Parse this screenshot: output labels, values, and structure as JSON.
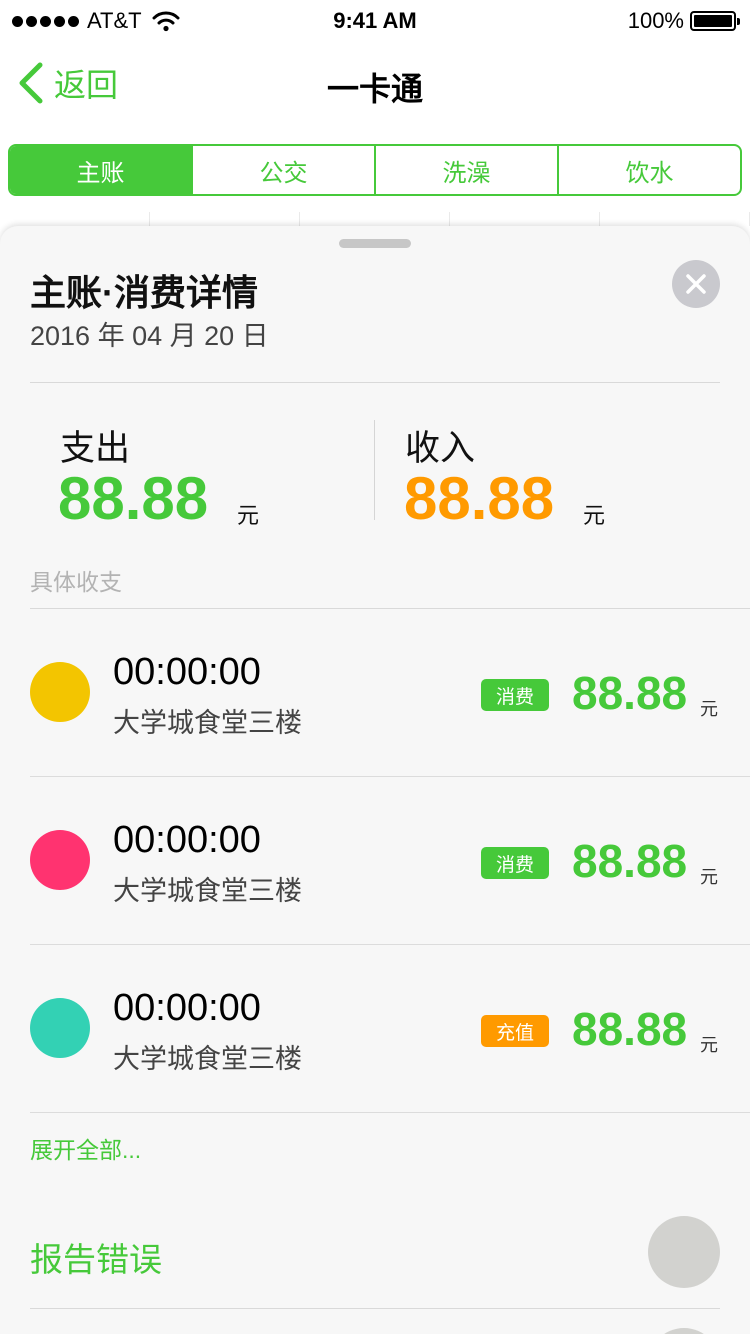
{
  "status_bar": {
    "carrier": "AT&T",
    "time": "9:41 AM",
    "battery": "100%"
  },
  "nav": {
    "back_label": "返回",
    "title": "一卡通"
  },
  "tabs": [
    {
      "label": "主账",
      "selected": true
    },
    {
      "label": "公交",
      "selected": false
    },
    {
      "label": "洗澡",
      "selected": false
    },
    {
      "label": "饮水",
      "selected": false
    }
  ],
  "sheet": {
    "title": "主账·消费详情",
    "date": "2016 年 04 月 20 日",
    "expense_label": "支出",
    "expense_amount": "88.88",
    "expense_unit": "元",
    "income_label": "收入",
    "income_amount": "88.88",
    "income_unit": "元",
    "section_label": "具体收支",
    "transactions": [
      {
        "time": "00:00:00",
        "place": "大学城食堂三楼",
        "type": "消费",
        "amount": "88.88",
        "unit": "元",
        "dot_color": "#f3c500",
        "badge_color": "#46c93a"
      },
      {
        "time": "00:00:00",
        "place": "大学城食堂三楼",
        "type": "消费",
        "amount": "88.88",
        "unit": "元",
        "dot_color": "#ff3370",
        "badge_color": "#46c93a"
      },
      {
        "time": "00:00:00",
        "place": "大学城食堂三楼",
        "type": "充值",
        "amount": "88.88",
        "unit": "元",
        "dot_color": "#33d1b4",
        "badge_color": "#ff9a00"
      }
    ],
    "expand_label": "展开全部...",
    "report_label": "报告错误"
  },
  "colors": {
    "accent_green": "#46c93a",
    "income_orange": "#ff9a00"
  }
}
